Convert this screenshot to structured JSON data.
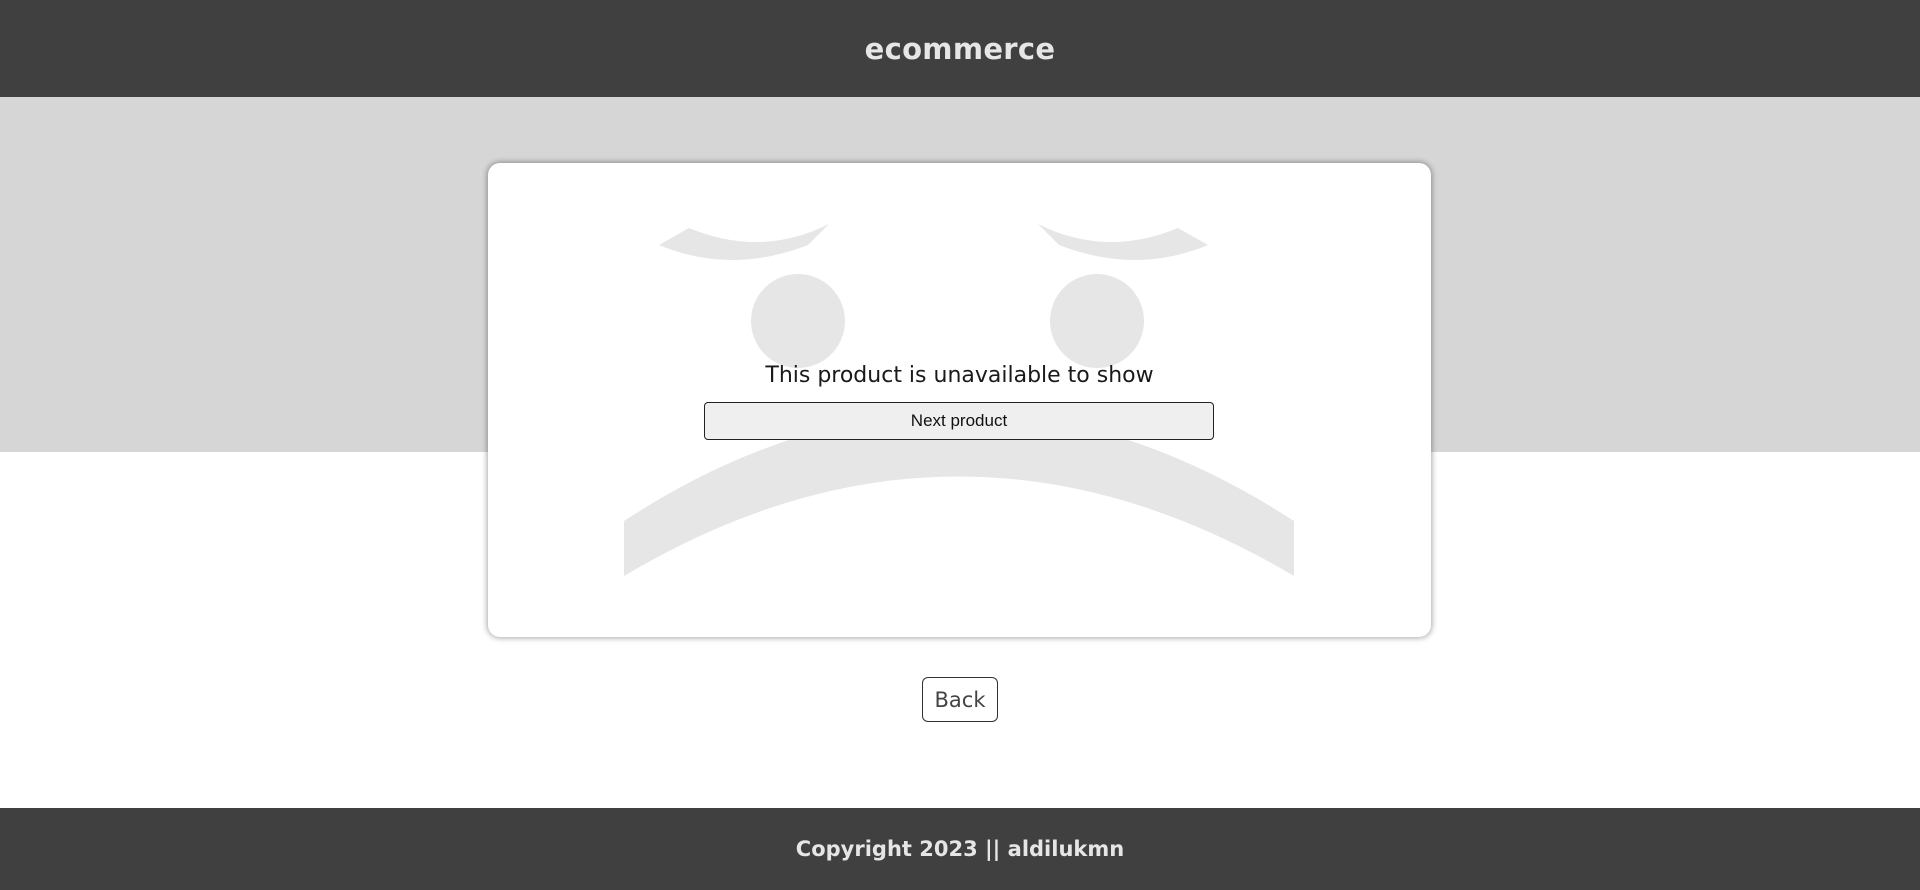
{
  "header": {
    "title": "ecommerce"
  },
  "product_card": {
    "message": "This product is unavailable to show",
    "next_button_label": "Next product",
    "illustration_icon": "sad-face-icon"
  },
  "back_button_label": "Back",
  "footer": {
    "copyright": "Copyright 2023 || aldilukmn"
  },
  "colors": {
    "header_bg": "#404040",
    "hero_band_bg": "#d6d6d6",
    "face_fill": "#e6e6e6",
    "footer_bg": "#404040"
  }
}
